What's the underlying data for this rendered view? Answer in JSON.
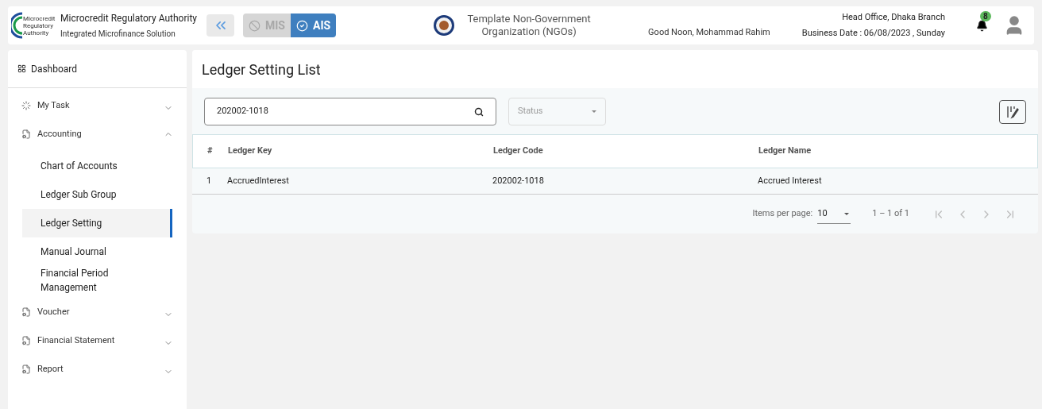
{
  "header": {
    "logo_text": [
      "Microcredit",
      "Regulatory",
      "Authority"
    ],
    "title": "Microcredit Regulatory Authority",
    "subtitle": "Integrated Microfinance Solution",
    "modules": [
      {
        "label": "MIS",
        "selected": false
      },
      {
        "label": "AIS",
        "selected": true
      }
    ],
    "organization": "Template Non-Government Organization (NGOs)",
    "greeting": "Good Noon, Mohammad Rahim",
    "branch": "Head Office, Dhaka Branch",
    "business_date": "Business Date : 06/08/2023 , Sunday",
    "notification_count": "8"
  },
  "sidebar": {
    "dashboard": "Dashboard",
    "items": [
      {
        "label": "My Task",
        "kind": "task",
        "expanded": false
      },
      {
        "label": "Accounting",
        "kind": "doc",
        "expanded": true,
        "children": [
          {
            "label": "Chart of Accounts",
            "selected": false
          },
          {
            "label": "Ledger Sub Group",
            "selected": false
          },
          {
            "label": "Ledger Setting",
            "selected": true
          },
          {
            "label": "Manual Journal",
            "selected": false
          },
          {
            "label": "Financial Period Management",
            "selected": false
          }
        ]
      },
      {
        "label": "Voucher",
        "kind": "doc",
        "expanded": false
      },
      {
        "label": "Financial Statement",
        "kind": "doc",
        "expanded": false
      },
      {
        "label": "Report",
        "kind": "doc",
        "expanded": false
      }
    ]
  },
  "page": {
    "title": "Ledger Setting List",
    "search": {
      "value": "202002-1018"
    },
    "status_filter": {
      "placeholder": "Status"
    },
    "table": {
      "columns": [
        "#",
        "Ledger Key",
        "Ledger Code",
        "Ledger Name"
      ],
      "rows": [
        [
          "1",
          "AccruedInterest",
          "202002-1018",
          "Accrued Interest"
        ]
      ]
    },
    "pagination": {
      "items_label": "Items per page:",
      "page_size": "10",
      "range": "1 – 1 of 1"
    }
  }
}
